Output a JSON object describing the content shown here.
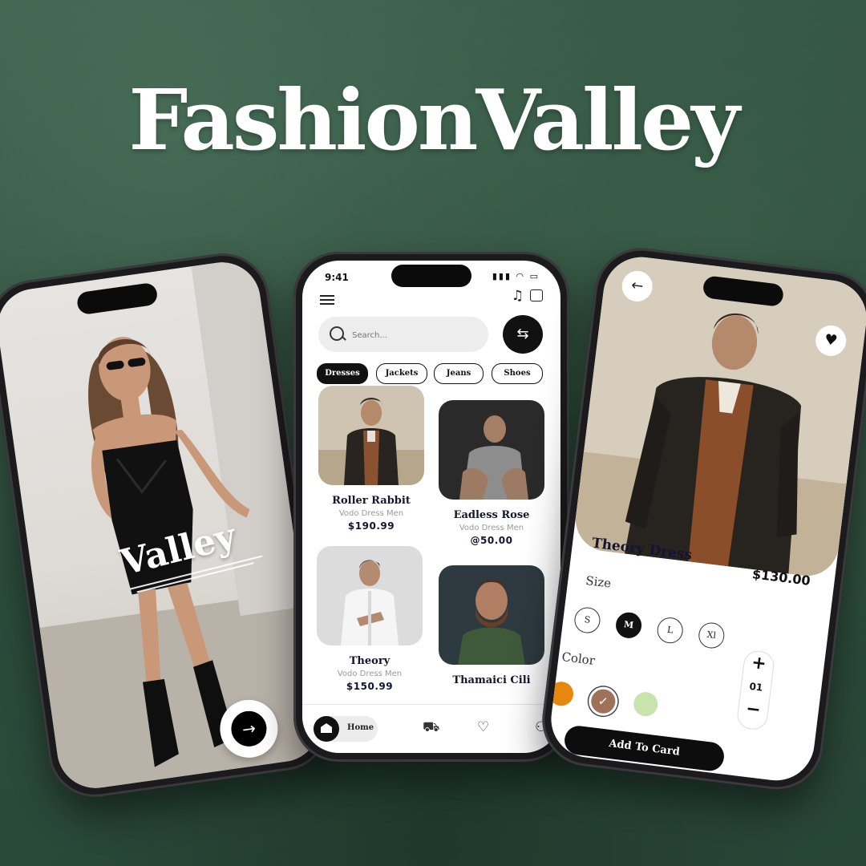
{
  "headline": "FashionValley",
  "welcome_screen": {
    "brand_word": "Valley",
    "next_icon": "arrow-right-icon"
  },
  "home_screen": {
    "status_time": "9:41",
    "search_placeholder": "Search...",
    "categories": [
      {
        "label": "Dresses",
        "active": true
      },
      {
        "label": "Jackets",
        "active": false
      },
      {
        "label": "Jeans",
        "active": false
      },
      {
        "label": "Shoes",
        "active": false
      }
    ],
    "products": [
      {
        "name": "Roller Rabbit",
        "subtitle": "Vodo Dress Men",
        "price": "$190.99"
      },
      {
        "name": "Eadless Rose",
        "subtitle": "Vodo Dress Men",
        "price": "@50.00"
      },
      {
        "name": "Theory",
        "subtitle": "Vodo Dress Men",
        "price": "$150.99"
      },
      {
        "name": "Thamaici Cili",
        "subtitle": "",
        "price": ""
      }
    ],
    "tabbar": {
      "home_label": "Home"
    }
  },
  "detail_screen": {
    "title": "Theory Dress",
    "price": "$130.00",
    "size_label": "Size",
    "sizes": [
      {
        "label": "S",
        "active": false
      },
      {
        "label": "M",
        "active": true
      },
      {
        "label": "L",
        "active": false
      },
      {
        "label": "Xl",
        "active": false
      }
    ],
    "color_label": "Color",
    "colors": [
      "#e8870e",
      "#a0715a",
      "#c9e3ae"
    ],
    "selected_color_index": 1,
    "quantity": "01",
    "add_button_label": "Add To Card"
  }
}
